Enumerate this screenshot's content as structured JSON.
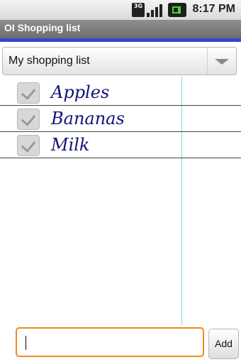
{
  "status_bar": {
    "network": "3G",
    "time": "8:17 PM"
  },
  "app": {
    "title": "OI Shopping list"
  },
  "list_selector": {
    "selected": "My shopping list"
  },
  "items": [
    {
      "label": "Apples",
      "checked": true
    },
    {
      "label": "Bananas",
      "checked": true
    },
    {
      "label": "Milk",
      "checked": true
    }
  ],
  "input": {
    "placeholder": ""
  },
  "add_button": {
    "label": "Add"
  },
  "colors": {
    "accent_bar": "#3a46c8",
    "input_focus": "#ef8a1f",
    "item_text": "#13137a",
    "margin_line": "#7fd7e3"
  }
}
